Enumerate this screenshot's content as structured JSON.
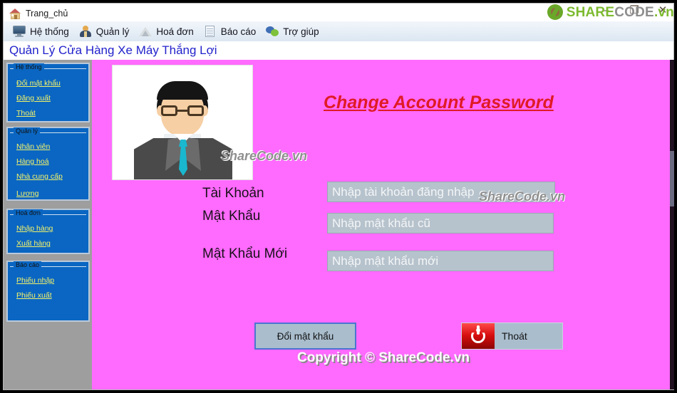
{
  "window": {
    "tab_label": "Trang_chủ",
    "tab_icon": "house-icon",
    "controls": {
      "minimize": "–",
      "maximize": "❐",
      "close": "✕"
    }
  },
  "watermark_logo": {
    "mark": "sharecode-circle-logo",
    "part1": "SHARE",
    "part2": "CODE",
    "part3": ".vn"
  },
  "menu": {
    "items": [
      {
        "label": "Hệ thống",
        "icon": "monitor-icon"
      },
      {
        "label": "Quản lý",
        "icon": "person-icon"
      },
      {
        "label": "Hoá đơn",
        "icon": "triangle-icon"
      },
      {
        "label": "Báo cáo",
        "icon": "document-icon"
      },
      {
        "label": "Trợ giúp",
        "icon": "chat-bubbles-icon"
      }
    ]
  },
  "app_heading": "Quản Lý Cửa Hàng Xe Máy Thắng Lợi",
  "sidebar": {
    "groups": [
      {
        "title": "Hệ thống",
        "items": [
          "Đổi mật khẩu",
          "Đăng xuất",
          "Thoát"
        ]
      },
      {
        "title": "Quản lý",
        "items": [
          "Nhân viên",
          "Hàng hoá",
          "Nhà cung cấp",
          "Lương"
        ]
      },
      {
        "title": "Hoá đơn",
        "items": [
          "Nhập hàng",
          "Xuất hàng"
        ]
      },
      {
        "title": "Báo cáo",
        "items": [
          "Phiếu nhập",
          "Phiếu xuất"
        ]
      }
    ]
  },
  "main": {
    "avatar_alt": "user-avatar-illustration",
    "headline": "Change Account Password",
    "fields": [
      {
        "label": "Tài Khoản",
        "value": "",
        "placeholder": "Nhập tài khoản đăng nhập"
      },
      {
        "label": "Mật Khẩu",
        "value": "",
        "placeholder": "Nhập mật khẩu cũ"
      },
      {
        "label": "Mật Khẩu Mới",
        "value": "",
        "placeholder": "Nhập mật khẩu mới"
      }
    ],
    "buttons": {
      "submit": "Đổi mật khẩu",
      "exit": "Thoát",
      "exit_icon": "power-icon"
    },
    "copyright": "Copyright © ShareCode.vn",
    "watermarks": [
      "ShareCode.vn",
      "ShareCode.vn"
    ]
  },
  "colors": {
    "panel_pink": "#ff6aff",
    "sidebar_blue": "#0a66c2",
    "link_yellow": "#f5f36a",
    "headline_red": "#e01b24",
    "heading_blue": "#2222cc",
    "input_gray": "#b6c2cc",
    "accent_green": "#7dba2f"
  }
}
